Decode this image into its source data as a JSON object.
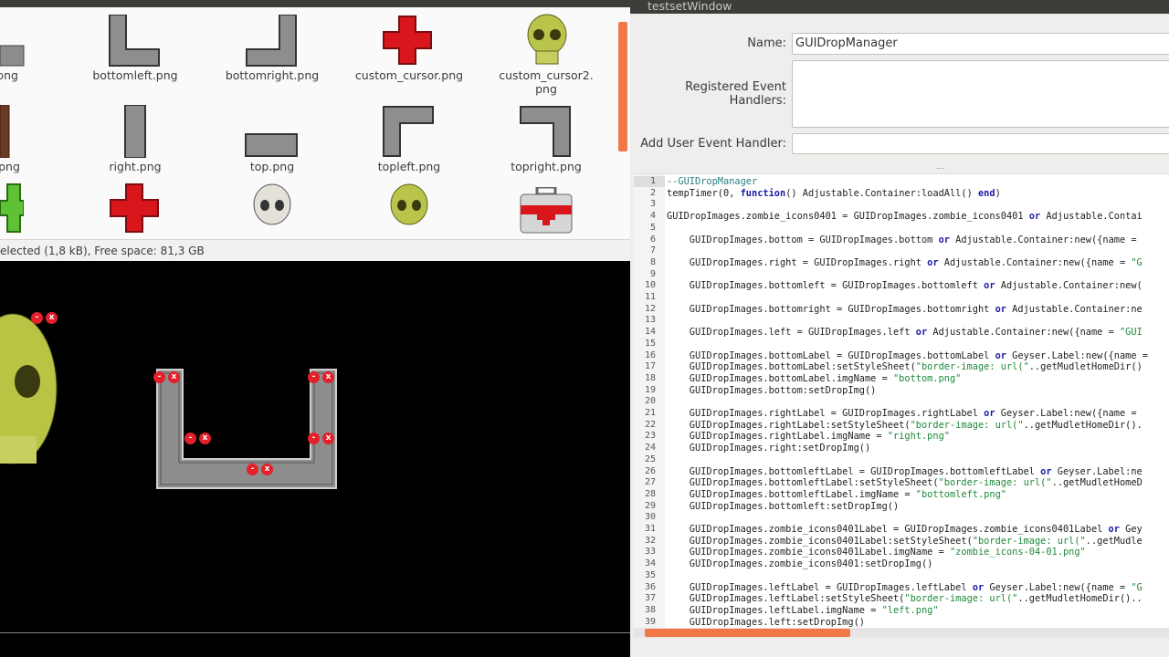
{
  "file_manager": {
    "row1": [
      "m.png",
      "bottomleft.png",
      "bottomright.png",
      "custom_cursor.png",
      "custom_cursor2.\npng"
    ],
    "row2": [
      "png",
      "right.png",
      "top.png",
      "topleft.png",
      "topright.png"
    ],
    "status": "elected (1,8 kB), Free space: 81,3 GB"
  },
  "window": {
    "title": "testsetWindow",
    "name_label": "Name:",
    "name_value": "GUIDropManager",
    "registered_label": "Registered Event\nHandlers:",
    "add_label": "Add User Event Handler:"
  },
  "editor": {
    "lines": [
      {
        "n": "1",
        "t": "--GUIDropManager"
      },
      {
        "n": "2",
        "t": "tempTimer(0, function() Adjustable.Container:loadAll() end)"
      },
      {
        "n": "3",
        "t": ""
      },
      {
        "n": "4",
        "t": "GUIDropImages.zombie_icons0401 = GUIDropImages.zombie_icons0401 or Adjustable.Contai"
      },
      {
        "n": "5",
        "t": ""
      },
      {
        "n": "6",
        "t": "    GUIDropImages.bottom = GUIDropImages.bottom or Adjustable.Container:new({name = "
      },
      {
        "n": "7",
        "t": ""
      },
      {
        "n": "8",
        "t": "    GUIDropImages.right = GUIDropImages.right or Adjustable.Container:new({name = \"G"
      },
      {
        "n": "9",
        "t": ""
      },
      {
        "n": "10",
        "t": "    GUIDropImages.bottomleft = GUIDropImages.bottomleft or Adjustable.Container:new("
      },
      {
        "n": "11",
        "t": ""
      },
      {
        "n": "12",
        "t": "    GUIDropImages.bottomright = GUIDropImages.bottomright or Adjustable.Container:ne"
      },
      {
        "n": "13",
        "t": ""
      },
      {
        "n": "14",
        "t": "    GUIDropImages.left = GUIDropImages.left or Adjustable.Container:new({name = \"GUI"
      },
      {
        "n": "15",
        "t": ""
      },
      {
        "n": "16",
        "t": "    GUIDropImages.bottomLabel = GUIDropImages.bottomLabel or Geyser.Label:new({name ="
      },
      {
        "n": "17",
        "t": "    GUIDropImages.bottomLabel:setStyleSheet(\"border-image: url(\"..getMudletHomeDir()"
      },
      {
        "n": "18",
        "t": "    GUIDropImages.bottomLabel.imgName = \"bottom.png\""
      },
      {
        "n": "19",
        "t": "    GUIDropImages.bottom:setDropImg()"
      },
      {
        "n": "20",
        "t": ""
      },
      {
        "n": "21",
        "t": "    GUIDropImages.rightLabel = GUIDropImages.rightLabel or Geyser.Label:new({name ="
      },
      {
        "n": "22",
        "t": "    GUIDropImages.rightLabel:setStyleSheet(\"border-image: url(\"..getMudletHomeDir()."
      },
      {
        "n": "23",
        "t": "    GUIDropImages.rightLabel.imgName = \"right.png\""
      },
      {
        "n": "24",
        "t": "    GUIDropImages.right:setDropImg()"
      },
      {
        "n": "25",
        "t": ""
      },
      {
        "n": "26",
        "t": "    GUIDropImages.bottomleftLabel = GUIDropImages.bottomleftLabel or Geyser.Label:ne"
      },
      {
        "n": "27",
        "t": "    GUIDropImages.bottomleftLabel:setStyleSheet(\"border-image: url(\"..getMudletHomeD"
      },
      {
        "n": "28",
        "t": "    GUIDropImages.bottomleftLabel.imgName = \"bottomleft.png\""
      },
      {
        "n": "29",
        "t": "    GUIDropImages.bottomleft:setDropImg()"
      },
      {
        "n": "30",
        "t": ""
      },
      {
        "n": "31",
        "t": "    GUIDropImages.zombie_icons0401Label = GUIDropImages.zombie_icons0401Label or Gey"
      },
      {
        "n": "32",
        "t": "    GUIDropImages.zombie_icons0401Label:setStyleSheet(\"border-image: url(\"..getMudle"
      },
      {
        "n": "33",
        "t": "    GUIDropImages.zombie_icons0401Label.imgName = \"zombie_icons-04-01.png\""
      },
      {
        "n": "34",
        "t": "    GUIDropImages.zombie_icons0401:setDropImg()"
      },
      {
        "n": "35",
        "t": ""
      },
      {
        "n": "36",
        "t": "    GUIDropImages.leftLabel = GUIDropImages.leftLabel or Geyser.Label:new({name = \"G"
      },
      {
        "n": "37",
        "t": "    GUIDropImages.leftLabel:setStyleSheet(\"border-image: url(\"..getMudletHomeDir().."
      },
      {
        "n": "38",
        "t": "    GUIDropImages.leftLabel.imgName = \"left.png\""
      },
      {
        "n": "39",
        "t": "    GUIDropImages.left:setDropImg()"
      }
    ]
  },
  "colors": {
    "accent": "#f07746",
    "close_red": "#e4202b"
  },
  "icons": [
    "skull-icon",
    "red-cross-icon",
    "first-aid-kit-icon",
    "stone-frame-icon"
  ]
}
